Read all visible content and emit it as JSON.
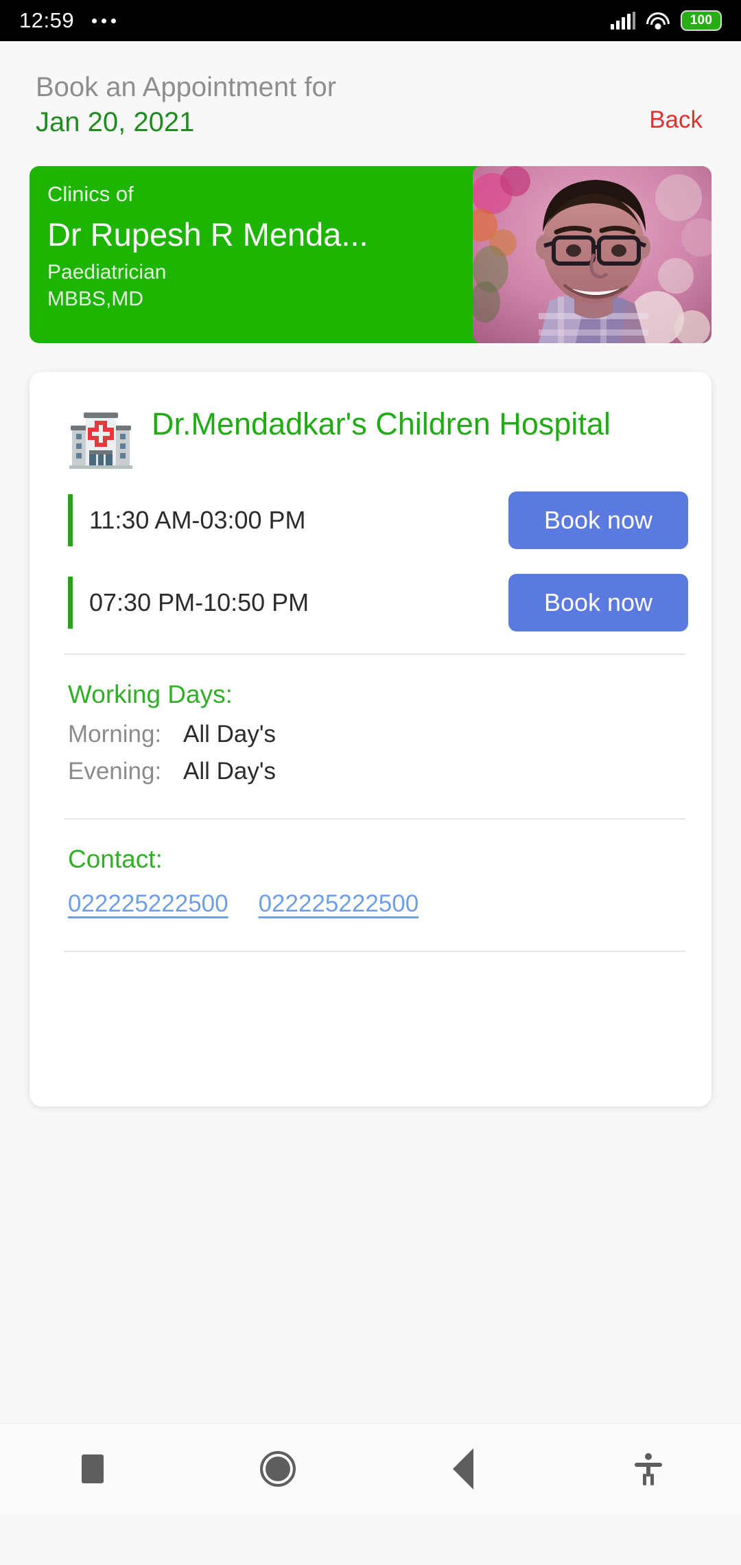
{
  "status_bar": {
    "time": "12:59",
    "overflow_icon": "more-dots-icon",
    "signal_icon": "cellular-signal-icon",
    "wifi_icon": "wifi-icon",
    "battery_level": "100"
  },
  "header": {
    "title": "Book an Appointment for",
    "date": "Jan 20, 2021",
    "back_label": "Back"
  },
  "doctor_banner": {
    "clinics_label": "Clinics of",
    "doctor_name": "Dr Rupesh R Menda...",
    "speciality": "Paediatrician",
    "degrees": "MBBS,MD",
    "photo_alt": "doctor-portrait",
    "background_color": "#1db501"
  },
  "clinic_card": {
    "hospital_icon": "hospital-building-icon",
    "hospital_name": "Dr.Mendadkar's Children Hospital",
    "slots": [
      {
        "time": "11:30 AM-03:00 PM",
        "button_label": "Book now"
      },
      {
        "time": "07:30 PM-10:50 PM",
        "button_label": "Book now"
      }
    ],
    "working_days": {
      "title": "Working Days:",
      "morning_label": "Morning:",
      "morning_value": "All Day's",
      "evening_label": "Evening:",
      "evening_value": "All Day's"
    },
    "contact": {
      "title": "Contact:",
      "numbers": [
        "022225222500",
        "022225222500"
      ]
    }
  },
  "nav_bar": {
    "recents_icon": "square-recents-icon",
    "home_icon": "circle-home-icon",
    "back_icon": "triangle-back-icon",
    "accessibility_icon": "accessibility-icon"
  },
  "colors": {
    "brand_green": "#1db501",
    "accent_blue": "#5a7ae0",
    "back_red": "#e03131",
    "link_blue": "#6e9ee8"
  }
}
